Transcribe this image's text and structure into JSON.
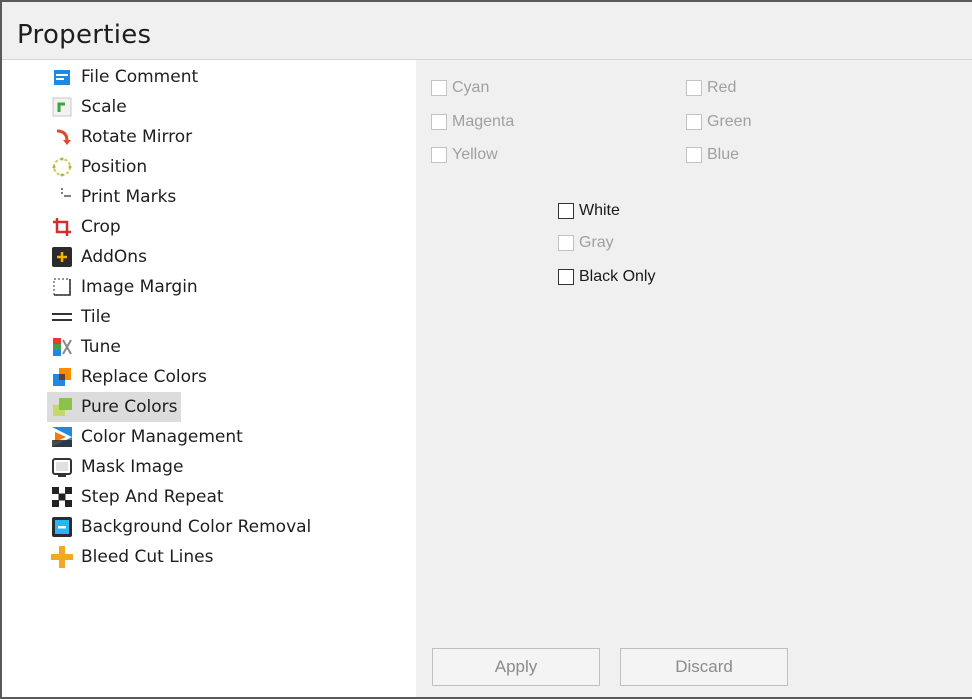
{
  "header": {
    "title": "Properties"
  },
  "sidebar": {
    "items": [
      {
        "label": "File Comment",
        "icon": "file-comment-icon"
      },
      {
        "label": "Scale",
        "icon": "scale-icon"
      },
      {
        "label": "Rotate Mirror",
        "icon": "rotate-mirror-icon"
      },
      {
        "label": "Position",
        "icon": "position-icon"
      },
      {
        "label": "Print Marks",
        "icon": "print-marks-icon"
      },
      {
        "label": "Crop",
        "icon": "crop-icon"
      },
      {
        "label": "AddOns",
        "icon": "addons-icon"
      },
      {
        "label": "Image Margin",
        "icon": "image-margin-icon"
      },
      {
        "label": "Tile",
        "icon": "tile-icon"
      },
      {
        "label": "Tune",
        "icon": "tune-icon"
      },
      {
        "label": "Replace Colors",
        "icon": "replace-colors-icon"
      },
      {
        "label": "Pure Colors",
        "icon": "pure-colors-icon",
        "selected": true
      },
      {
        "label": "Color Management",
        "icon": "color-management-icon"
      },
      {
        "label": "Mask Image",
        "icon": "mask-image-icon"
      },
      {
        "label": "Step And Repeat",
        "icon": "step-and-repeat-icon"
      },
      {
        "label": "Background Color Removal",
        "icon": "background-color-removal-icon"
      },
      {
        "label": "Bleed Cut Lines",
        "icon": "bleed-cut-lines-icon"
      }
    ]
  },
  "pure_colors": {
    "cmy": [
      "Cyan",
      "Magenta",
      "Yellow"
    ],
    "rgb": [
      "Red",
      "Green",
      "Blue"
    ],
    "white": "White",
    "gray": "Gray",
    "black_only": "Black Only"
  },
  "actions": {
    "apply": "Apply",
    "discard": "Discard"
  },
  "colors": {
    "header_bg": "#f0f0f0",
    "content_bg": "#f0f0f0",
    "selected_bg": "#dcdcdc",
    "disabled_text": "#a0a0a0"
  }
}
